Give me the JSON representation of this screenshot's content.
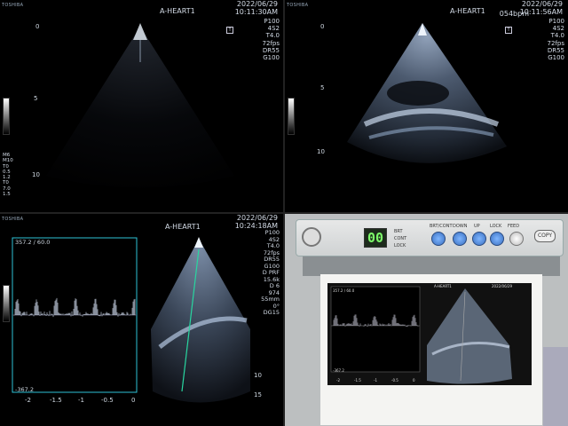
{
  "brand": "TOSHIBA",
  "exam_title": "A-HEART1",
  "q1": {
    "date": "2022/06/29",
    "time": "10:11:30AM",
    "params": [
      "P100",
      "4S2",
      "T4.0",
      "72fps",
      "DR55",
      "G100"
    ],
    "depth_labels": [
      "0",
      "5",
      "10"
    ],
    "side_params": [
      "M6",
      "M10",
      "T0",
      "0.5",
      "1.2",
      "T0",
      "7.0",
      "1.5"
    ]
  },
  "q2": {
    "date": "2022/06/29",
    "time": "10:11:56AM",
    "bpm": "054bpm",
    "params": [
      "P100",
      "4S2",
      "T4.0",
      "72fps",
      "DR55",
      "G100"
    ],
    "depth_labels": [
      "0",
      "5",
      "10"
    ]
  },
  "q3": {
    "date": "2022/06/29",
    "time": "10:24:18AM",
    "params": [
      "P100",
      "4S2",
      "T4.0",
      "72fps",
      "DR55",
      "G100",
      "D PRF",
      "15.6k",
      "D 6",
      "974",
      "55mm",
      "0°",
      "DG15"
    ],
    "scale_top": "357.2 / 60.0",
    "scale_bottom": "-367.2",
    "time_ticks": [
      "-2",
      "-1.5",
      "-1",
      "-0.5",
      "0"
    ],
    "depth_labels": [
      "10",
      "15"
    ]
  },
  "q4": {
    "led": "00",
    "indicators": [
      "BRT",
      "CONT",
      "LOCK"
    ],
    "buttons": [
      "BRT/CONT",
      "DOWN",
      "UP",
      "LOCK",
      "FEED"
    ],
    "copy": "COPY",
    "print_title": "A-HEART1",
    "print_date": "2022/06/29",
    "print_scale": "357.2 / 60.0",
    "print_scale_bottom": "-367.2",
    "print_ticks": [
      "-2",
      "-1.5",
      "-1",
      "-0.5",
      "0"
    ]
  }
}
